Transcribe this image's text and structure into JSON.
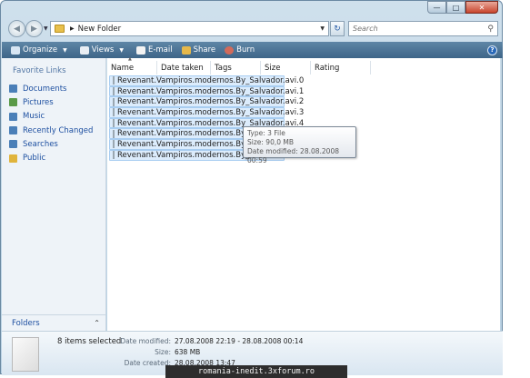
{
  "window": {
    "caption_buttons": [
      "minimize",
      "maximize",
      "close"
    ]
  },
  "address_bar": {
    "path_folder": "New Folder"
  },
  "search": {
    "placeholder": "Search"
  },
  "toolbar": {
    "organize": "Organize",
    "views": "Views",
    "email": "E-mail",
    "share": "Share",
    "burn": "Burn"
  },
  "nav_pane": {
    "title": "Favorite Links",
    "items": [
      {
        "label": "Documents",
        "icon": "documents-icon",
        "color": "#4a7fb8"
      },
      {
        "label": "Pictures",
        "icon": "pictures-icon",
        "color": "#5a9a48"
      },
      {
        "label": "Music",
        "icon": "music-icon",
        "color": "#4a7fb8"
      },
      {
        "label": "Recently Changed",
        "icon": "recent-icon",
        "color": "#4a7fb8"
      },
      {
        "label": "Searches",
        "icon": "searches-icon",
        "color": "#4a7fb8"
      },
      {
        "label": "Public",
        "icon": "public-folder-icon",
        "color": "#e0b43c"
      }
    ],
    "folders_label": "Folders"
  },
  "columns": [
    "Name",
    "Date taken",
    "Tags",
    "Size",
    "Rating"
  ],
  "files": [
    "Revenant.Vampiros.modernos.By_Salvador.avi.0",
    "Revenant.Vampiros.modernos.By_Salvador.avi.1",
    "Revenant.Vampiros.modernos.By_Salvador.avi.2",
    "Revenant.Vampiros.modernos.By_Salvador.avi.3",
    "Revenant.Vampiros.modernos.By_Salvador.avi.4",
    "Revenant.Vampiros.modernos.By_Salvador.avi.5",
    "Revenant.Vampiros.modernos.By_Salvador.avi.6",
    "Revenant.Vampiros.modernos.By_Salvador.avi.7"
  ],
  "tooltip": {
    "type": "Type: 3 File",
    "size": "Size: 90,0 MB",
    "modified": "Date modified: 28.08.2008 00:59"
  },
  "details": {
    "selected": "8 items selected",
    "date_modified_label": "Date modified:",
    "date_modified_value": "27.08.2008 22:19 - 28.08.2008 00:14",
    "size_label": "Size:",
    "size_value": "638 MB",
    "date_created_label": "Date created:",
    "date_created_value": "28.08.2008 13:47"
  },
  "watermark": "romania-inedit.3xforum.ro"
}
